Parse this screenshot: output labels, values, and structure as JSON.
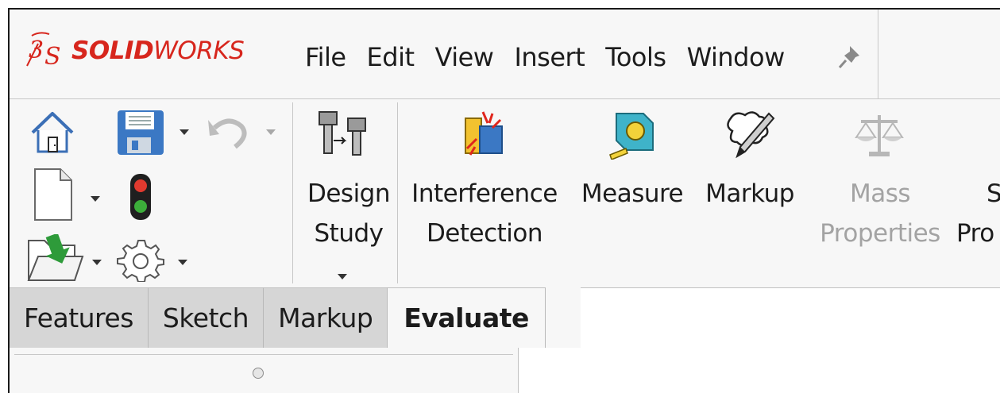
{
  "app": {
    "logo_prefix": "SOLID",
    "logo_suffix": "WORKS",
    "brand_color": "#d7261d"
  },
  "menu": [
    "File",
    "Edit",
    "View",
    "Insert",
    "Tools",
    "Window"
  ],
  "toolbar": {
    "design_study": {
      "line1": "Design",
      "line2": "Study"
    },
    "interference": {
      "line1": "Interference",
      "line2": "Detection"
    },
    "measure": {
      "line1": "Measure"
    },
    "markup": {
      "line1": "Markup"
    },
    "mass_properties": {
      "line1": "Mass",
      "line2": "Properties"
    },
    "section_properties": {
      "line1": "Se",
      "line2": "Pro"
    }
  },
  "tabs": [
    "Features",
    "Sketch",
    "Markup",
    "Evaluate"
  ],
  "active_tab": "Evaluate",
  "icons": [
    "home-icon",
    "save-icon",
    "undo-icon",
    "new-document-icon",
    "rebuild-traffic-light-icon",
    "open-folder-icon",
    "options-gear-icon",
    "pin-icon"
  ]
}
